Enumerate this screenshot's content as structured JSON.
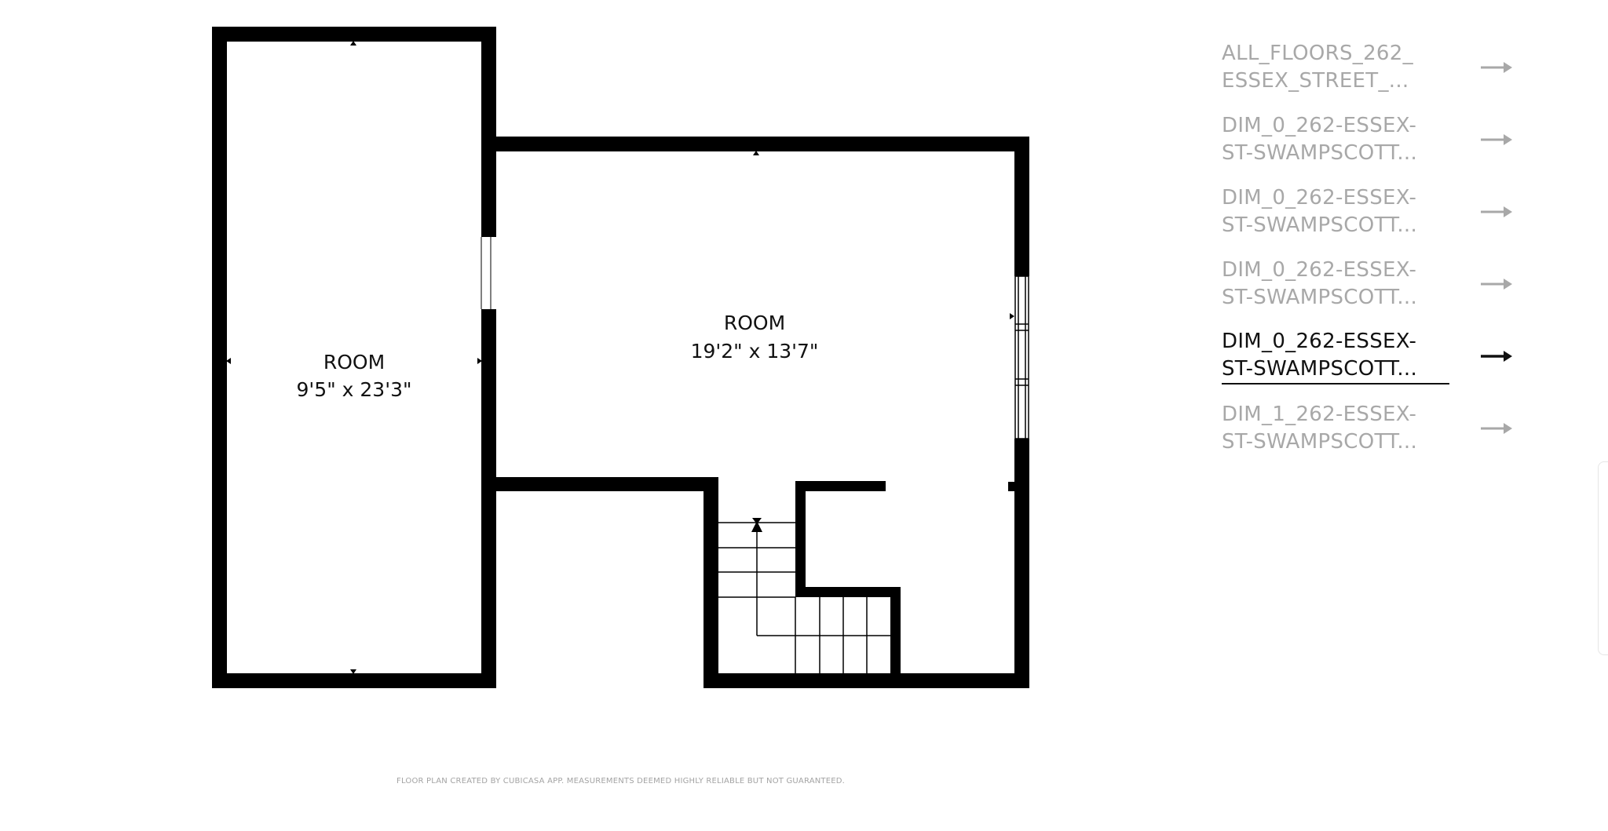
{
  "floor_plan": {
    "rooms": [
      {
        "name": "ROOM",
        "dimensions": "9'5\" x 23'3\""
      },
      {
        "name": "ROOM",
        "dimensions": "19'2\" x 13'7\""
      }
    ],
    "disclaimer": "FLOOR PLAN CREATED BY CUBICASA APP. MEASUREMENTS DEEMED HIGHLY RELIABLE BUT NOT GUARANTEED."
  },
  "file_list": {
    "items": [
      {
        "line1": "ALL_FLOORS_262_",
        "line2": "ESSEX_STREET_...",
        "active": false
      },
      {
        "line1": "DIM_0_262-ESSEX-",
        "line2": "ST-SWAMPSCOTT...",
        "active": false
      },
      {
        "line1": "DIM_0_262-ESSEX-",
        "line2": "ST-SWAMPSCOTT...",
        "active": false
      },
      {
        "line1": "DIM_0_262-ESSEX-",
        "line2": "ST-SWAMPSCOTT...",
        "active": false
      },
      {
        "line1": "DIM_0_262-ESSEX-",
        "line2": "ST-SWAMPSCOTT...",
        "active": true
      },
      {
        "line1": "DIM_1_262-ESSEX-",
        "line2": "ST-SWAMPSCOTT...",
        "active": false
      }
    ],
    "arrow_icon": "arrow-right-icon",
    "active_color": "#111111",
    "inactive_color": "#a8a8a8"
  }
}
